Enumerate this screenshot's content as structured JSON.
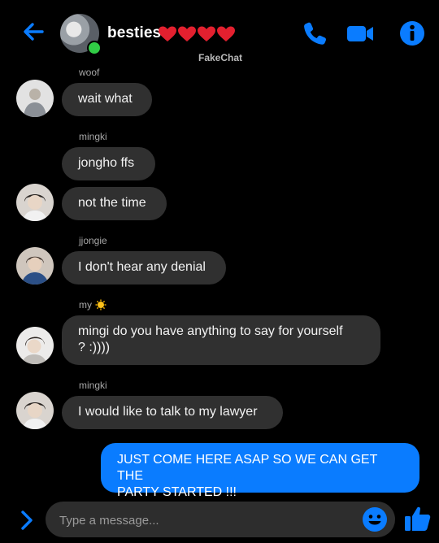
{
  "header": {
    "title": "besties",
    "hearts": [
      "heart",
      "heart",
      "heart",
      "heart"
    ],
    "watermark": "FakeChat",
    "accent": "#0a7cff"
  },
  "messages": [
    {
      "sender": "woof",
      "text": "wait what"
    },
    {
      "sender": "mingki",
      "text": "jongho ffs"
    },
    {
      "sender": "",
      "text": "not the time"
    },
    {
      "sender": "jjongie",
      "text": "I don't hear any denial"
    },
    {
      "sender": "my",
      "sender_emoji": "sun-face",
      "text_line1": "mingi do you have anything to say for yourself",
      "text_line2": "? :))))"
    },
    {
      "sender": "mingki",
      "text": "I would like to talk to my lawyer"
    }
  ],
  "outgoing": {
    "line1": "JUST COME HERE ASAP SO WE CAN GET THE",
    "line2": "PARTY STARTED !!!"
  },
  "composer": {
    "placeholder": "Type a message..."
  },
  "colors": {
    "background": "#000000",
    "incoming_bubble": "#303030",
    "outgoing_bubble": "#0a7cff",
    "online": "#31cc46"
  }
}
